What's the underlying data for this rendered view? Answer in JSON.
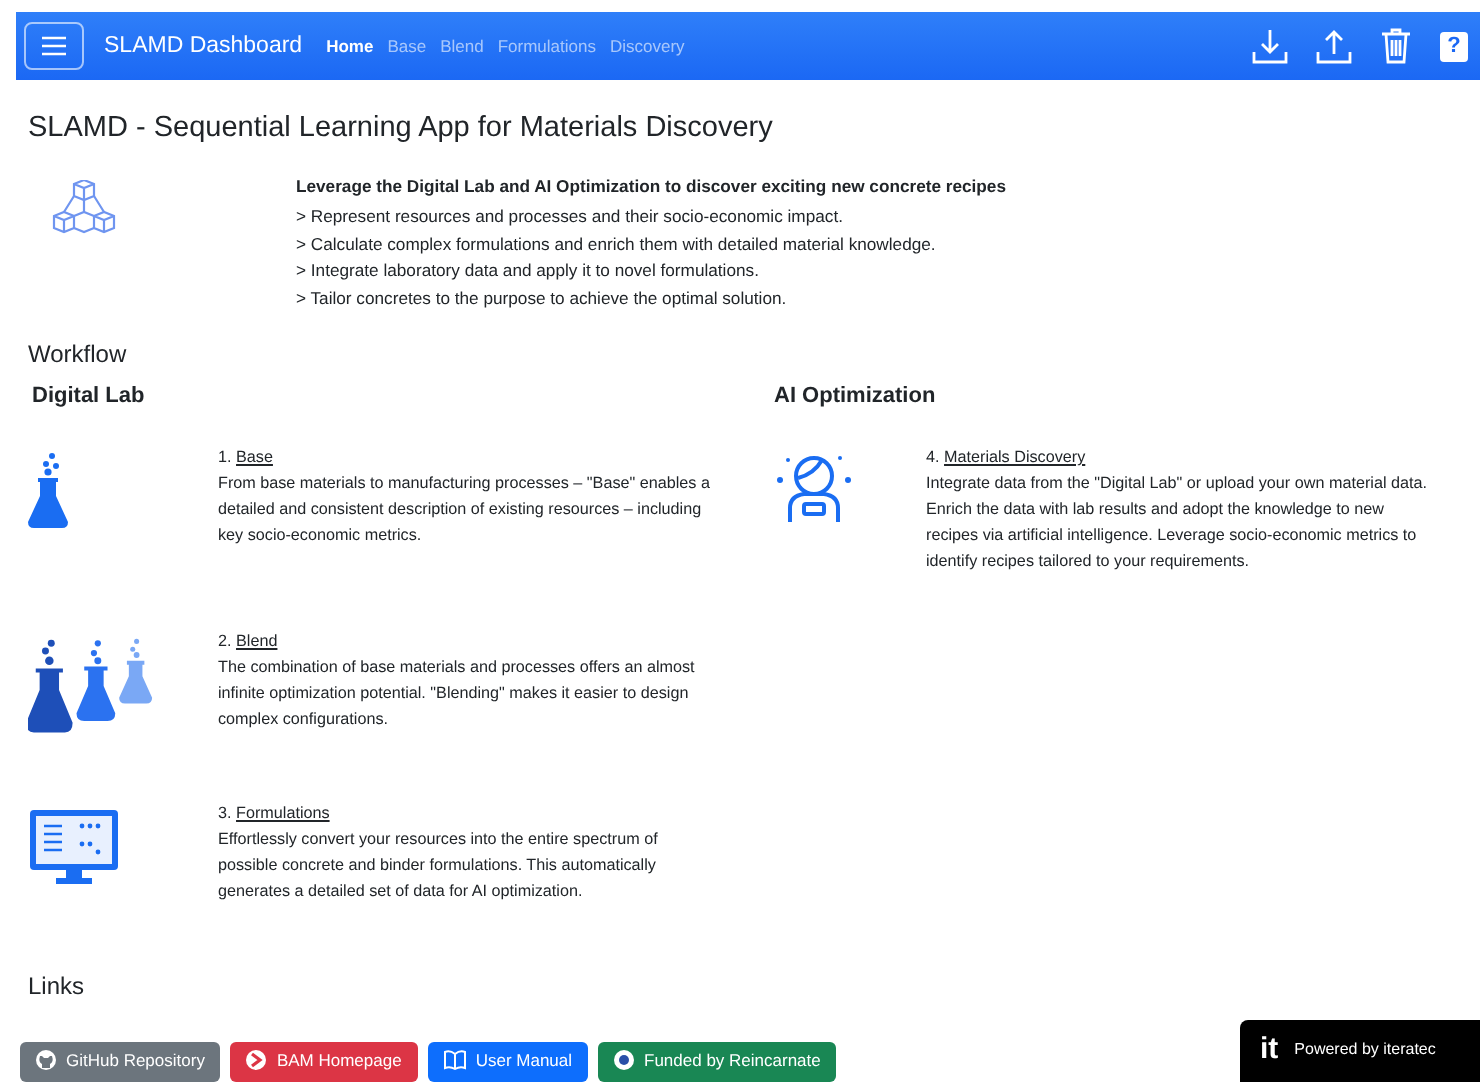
{
  "navbar": {
    "brand": "SLAMD Dashboard",
    "links": [
      {
        "label": "Home",
        "selected": true
      },
      {
        "label": "Base",
        "selected": false
      },
      {
        "label": "Blend",
        "selected": false
      },
      {
        "label": "Formulations",
        "selected": false
      },
      {
        "label": "Discovery",
        "selected": false
      }
    ],
    "help": "?"
  },
  "title": "SLAMD - Sequential Learning App for Materials Discovery",
  "intro": {
    "heading": "Leverage the Digital Lab and AI Optimization to discover exciting new concrete recipes",
    "lines": [
      "> Represent resources and processes and their socio-economic impact.",
      "> Calculate complex formulations and enrich them with detailed material knowledge.",
      "> Integrate laboratory data and apply it to novel formulations.",
      "> Tailor concretes to the purpose to achieve the optimal solution."
    ]
  },
  "workflow": {
    "heading": "Workflow",
    "columns": [
      {
        "heading": "Digital Lab",
        "items": [
          {
            "number": "1.",
            "link": "Base",
            "text": "From base materials to manufacturing processes – \"Base\" enables a detailed and consistent description of existing resources – including key socio-economic metrics."
          },
          {
            "number": "2.",
            "link": "Blend",
            "text": "The combination of base materials and processes offers an almost infinite optimization potential. \"Blending\" makes it easier to design complex configurations."
          },
          {
            "number": "3.",
            "link": "Formulations",
            "text": "Effortlessly convert your resources into the entire spectrum of possible concrete and binder formulations. This automatically generates a detailed set of data for AI optimization."
          }
        ]
      },
      {
        "heading": "AI Optimization",
        "items": [
          {
            "number": "4.",
            "link": "Materials Discovery",
            "text": "Integrate data from the \"Digital Lab\" or upload your own material data. Enrich the data with lab results and adopt the knowledge to new recipes via artificial intelligence. Leverage socio-economic metrics to identify recipes tailored to your requirements."
          }
        ]
      }
    ]
  },
  "links": {
    "heading": "Links",
    "buttons": [
      {
        "label": "GitHub Repository",
        "color": "#6c757d"
      },
      {
        "label": "BAM Homepage",
        "color": "#dc3545"
      },
      {
        "label": "User Manual",
        "color": "#0d6efd"
      },
      {
        "label": "Funded by Reincarnate",
        "color": "#198754"
      }
    ]
  },
  "badge": {
    "logo": "it",
    "label": "Powered by iteratec"
  }
}
